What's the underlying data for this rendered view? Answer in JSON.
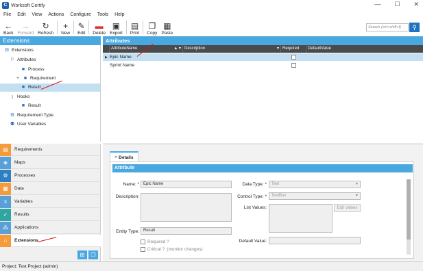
{
  "window": {
    "title": "Worksoft Certify",
    "app_icon_letter": "C",
    "controls": [
      "—",
      "☐",
      "✕"
    ]
  },
  "menu": [
    "File",
    "Edit",
    "View",
    "Actions",
    "Configure",
    "Tools",
    "Help"
  ],
  "toolbar": {
    "back": "Back",
    "forward": "Forward",
    "refresh": "Refresh",
    "new": "New",
    "edit": "Edit",
    "delete": "Delete",
    "export": "Export",
    "print": "Print",
    "copy": "Copy",
    "paste": "Paste",
    "search_placeholder": "Search (ctrl+shift+f)"
  },
  "left_panel": {
    "title": "Extensions",
    "tree": [
      {
        "label": "Extensions",
        "icon": "extensions-icon"
      },
      {
        "label": "Attributes",
        "icon": "attributes-icon"
      },
      {
        "label": "Process",
        "icon": "folder-icon"
      },
      {
        "label": "Requirement",
        "icon": "folder-icon"
      },
      {
        "label": "Result",
        "icon": "folder-icon"
      },
      {
        "label": "Hooks",
        "icon": "hooks-icon"
      },
      {
        "label": "Result",
        "icon": "folder-icon"
      },
      {
        "label": "Requirement Type",
        "icon": "requirement-type-icon"
      },
      {
        "label": "User Variables",
        "icon": "user-variables-icon"
      }
    ],
    "nav": [
      {
        "label": "Requirements",
        "color": "#f59b3a"
      },
      {
        "label": "Maps",
        "color": "#5aa0d8"
      },
      {
        "label": "Processes",
        "color": "#2f7fc1"
      },
      {
        "label": "Data",
        "color": "#f59b3a"
      },
      {
        "label": "Variables",
        "color": "#5aa0d8"
      },
      {
        "label": "Results",
        "color": "#2fa7a0"
      },
      {
        "label": "Applications",
        "color": "#5aa0d8"
      },
      {
        "label": "Extensions",
        "color": "#f59b3a"
      }
    ]
  },
  "attributes_panel": {
    "title": "Attributes",
    "columns": [
      "AttributeName",
      "Description",
      "Required",
      "DefaultValue"
    ],
    "rows": [
      {
        "name": "Epic Name",
        "description": "",
        "default": ""
      },
      {
        "name": "Sprint Name",
        "description": "",
        "default": ""
      }
    ]
  },
  "details": {
    "tab": "Details",
    "section": "Attribute",
    "name_label": "Name: *",
    "name_value": "Epic Name",
    "description_label": "Description:",
    "entity_type_label": "Entity Type:",
    "entity_type_value": "Result",
    "required_label": "Required ?",
    "critical_label": "Critical ?",
    "critical_note": "(monitor changes)",
    "data_type_label": "Data Type: *",
    "data_type_value": "Text",
    "control_type_label": "Control Type: *",
    "control_type_value": "TextBox",
    "list_values_label": "List Values:",
    "edit_values_button": "Edit Values",
    "default_value_label": "Default Value:"
  },
  "status": "Project: Test Project (admin)"
}
